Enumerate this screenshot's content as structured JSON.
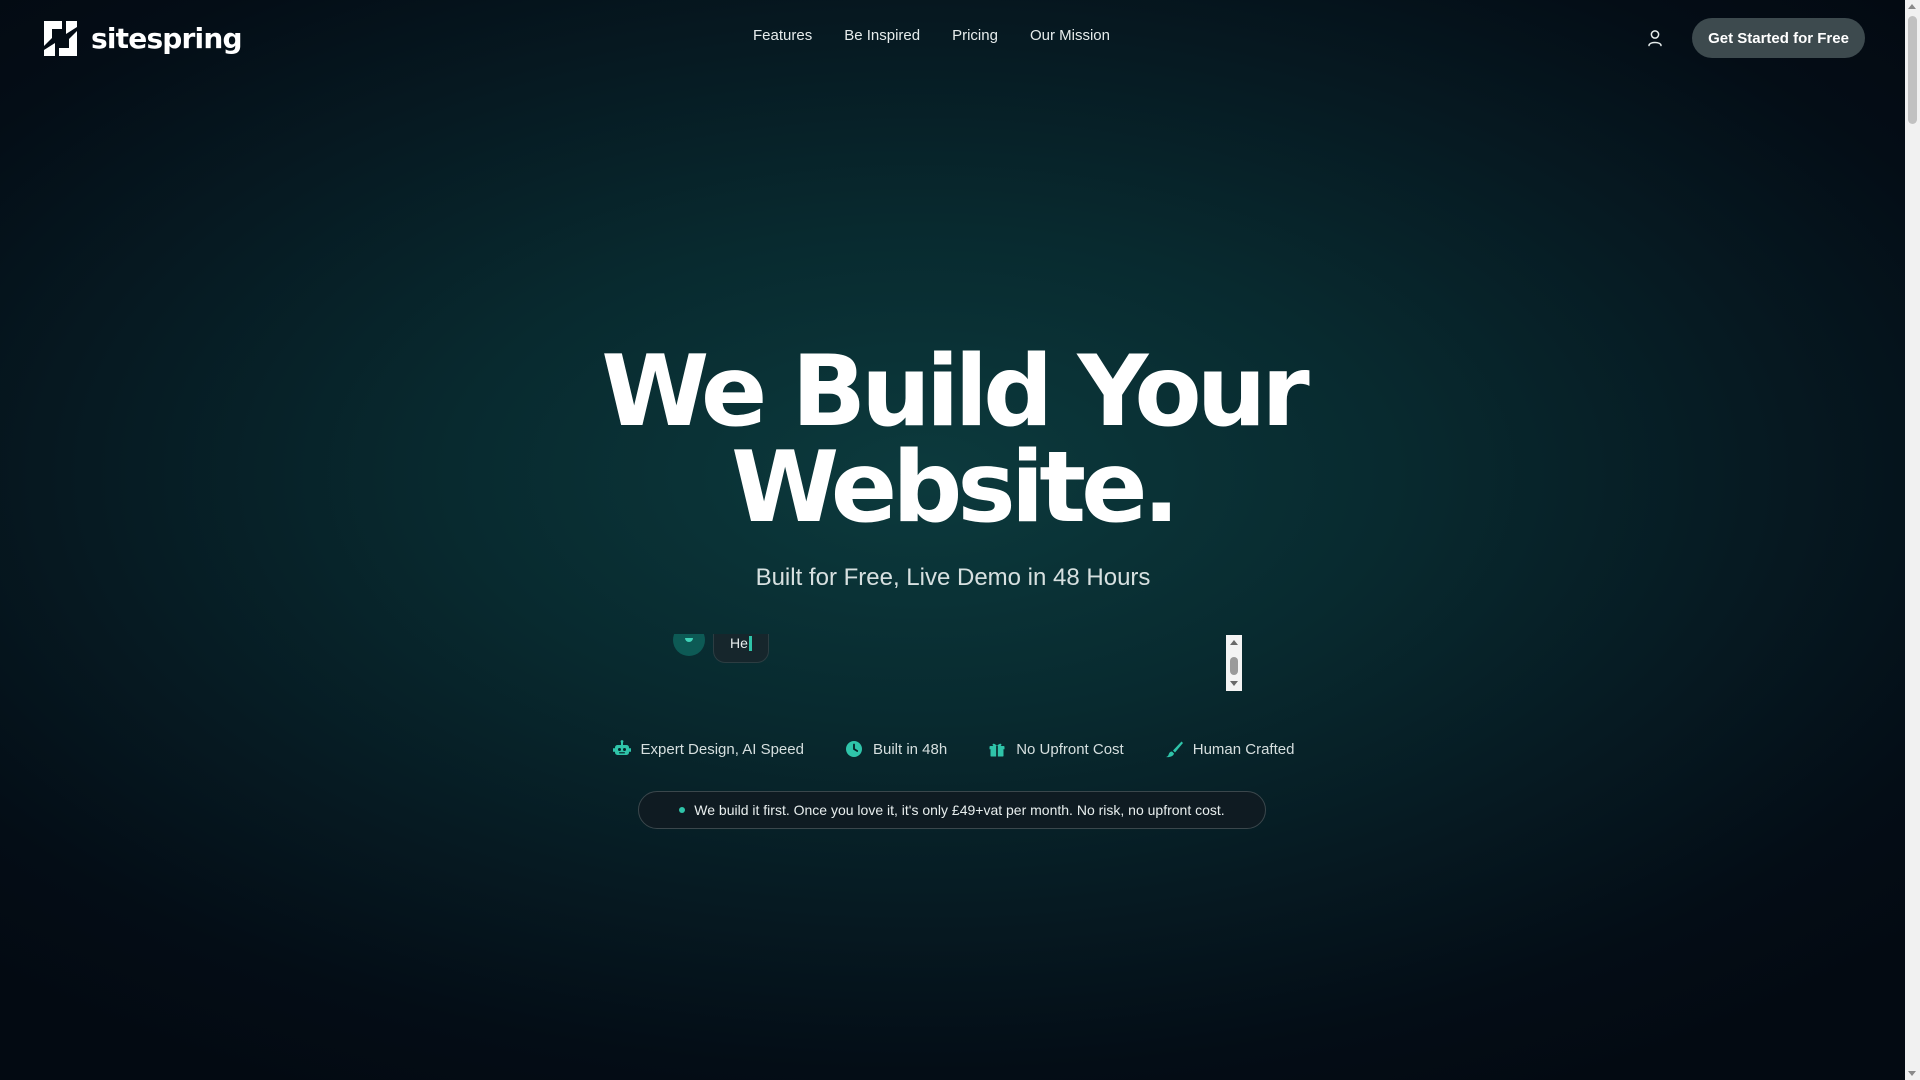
{
  "brand": {
    "name": "sitespring"
  },
  "nav": {
    "items": [
      {
        "label": "Features"
      },
      {
        "label": "Be Inspired"
      },
      {
        "label": "Pricing"
      },
      {
        "label": "Our Mission"
      }
    ]
  },
  "header": {
    "account_icon": "user-icon",
    "cta_label": "Get Started for Free"
  },
  "hero": {
    "title_line1": "We Build Your",
    "title_line2": "Website.",
    "subtitle": "Built for Free, Live Demo in 48 Hours"
  },
  "chat": {
    "message": "He"
  },
  "features": [
    {
      "icon": "robot-icon",
      "label": "Expert Design, AI Speed"
    },
    {
      "icon": "clock-icon",
      "label": "Built in 48h"
    },
    {
      "icon": "gift-icon",
      "label": "No Upfront Cost"
    },
    {
      "icon": "brush-icon",
      "label": "Human Crafted"
    }
  ],
  "notice": {
    "text": "We build it first. Once you love it, it's only £49+vat per month. No risk, no upfront cost."
  },
  "colors": {
    "accent": "#2fc4a9",
    "cta_bg": "#3d4a4e",
    "bg_dark": "#040d16",
    "bg_teal": "#0c3a3d"
  }
}
